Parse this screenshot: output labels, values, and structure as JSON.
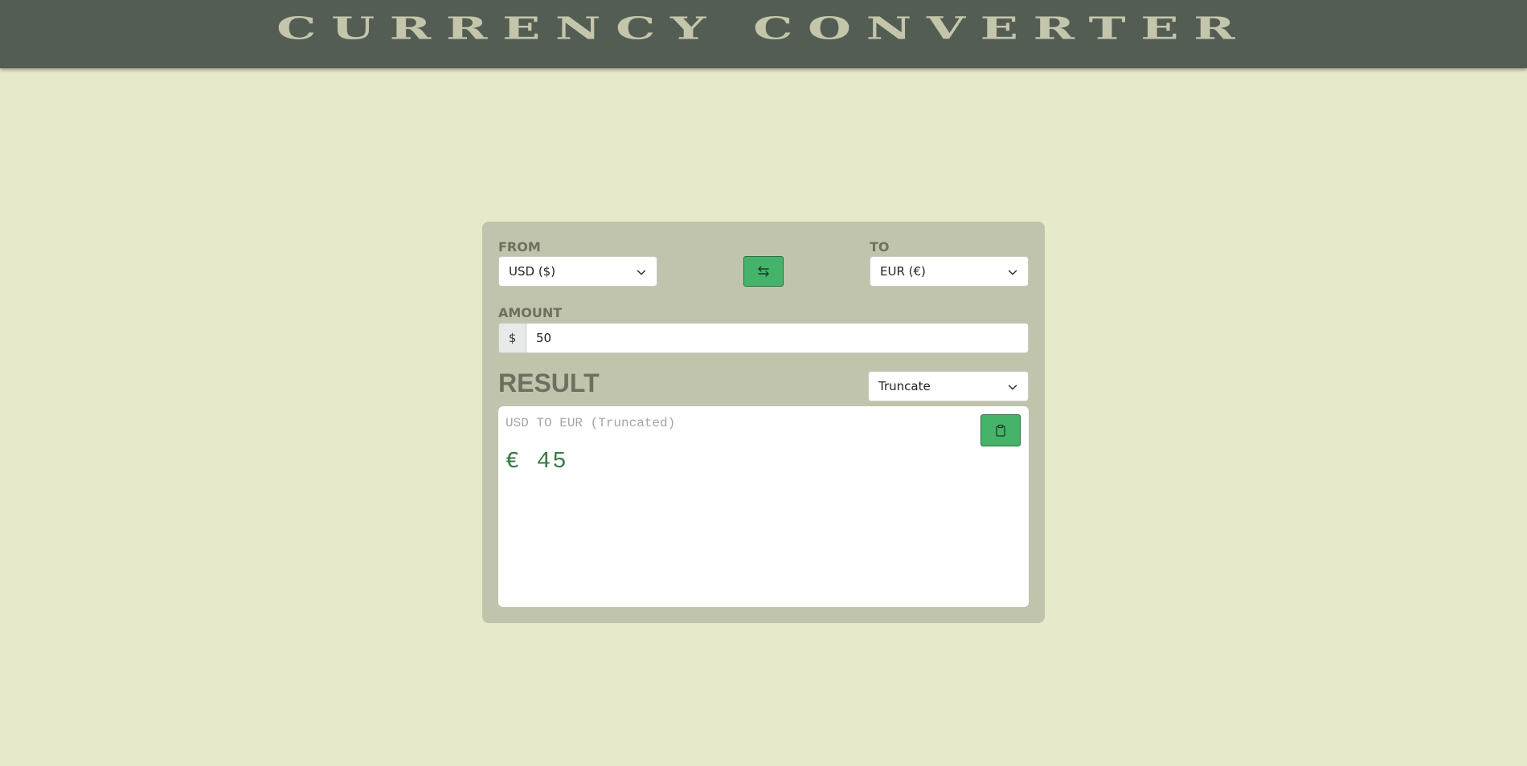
{
  "header": {
    "title": "Currency Converter"
  },
  "converter": {
    "from": {
      "label": "FROM",
      "selected": "USD ($)"
    },
    "to": {
      "label": "TO",
      "selected": "EUR (€)"
    },
    "swap_icon": "swap-arrows-icon",
    "amount": {
      "label": "AMOUNT",
      "prefix": "$",
      "value": "50"
    },
    "result": {
      "title": "RESULT",
      "rounding_mode": "Truncate",
      "caption": "USD TO EUR (Truncated)",
      "value": "€ 45",
      "copy_icon": "clipboard-icon"
    }
  },
  "colors": {
    "page_bg": "#e6e9ca",
    "header_bg": "#545d53",
    "card_bg": "#c1c4ad",
    "accent": "#45b46a",
    "result_text": "#3c7a47"
  }
}
